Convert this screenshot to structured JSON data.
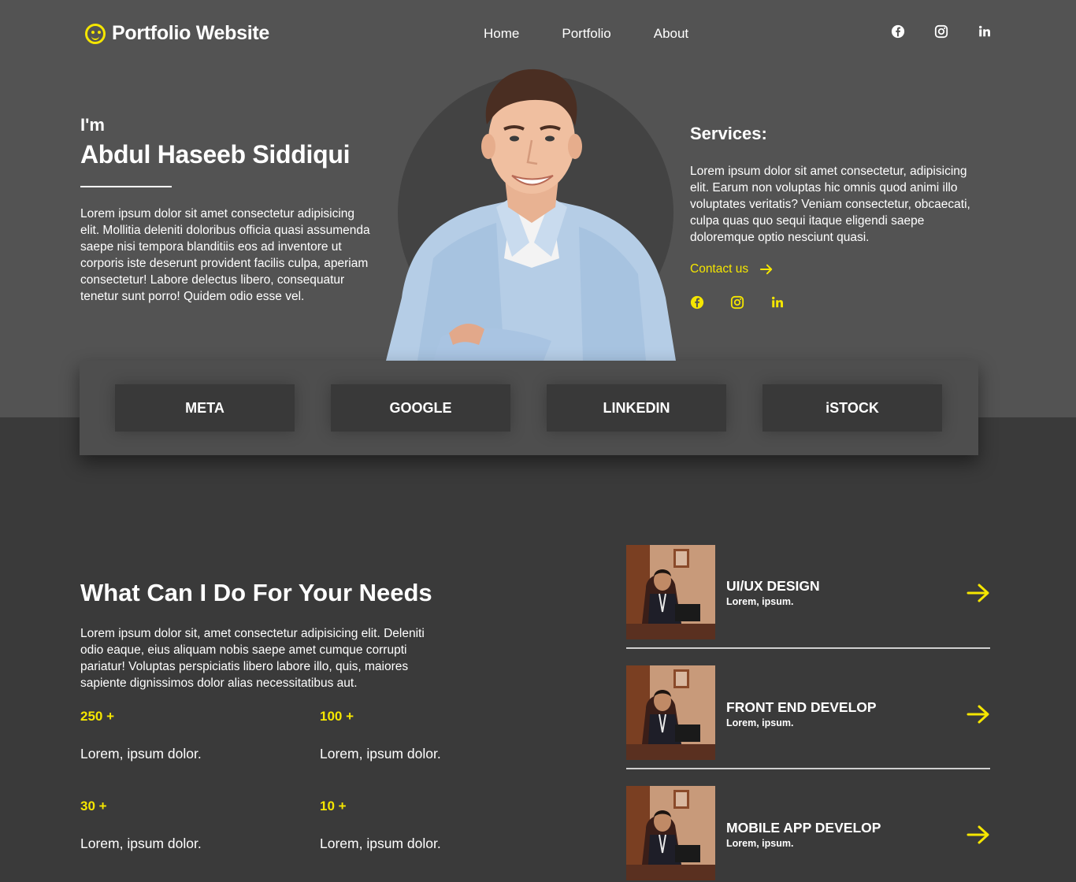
{
  "brand": {
    "logo_text": "Portfolio Website"
  },
  "nav": {
    "items": [
      "Home",
      "Portfolio",
      "About"
    ]
  },
  "hero": {
    "intro": "I'm",
    "name": "Abdul Haseeb Siddiqui",
    "bio": "Lorem ipsum dolor sit amet consectetur adipisicing elit. Mollitia deleniti doloribus officia quasi assumenda saepe nisi tempora blanditiis eos ad inventore ut corporis iste deserunt provident facilis culpa, aperiam consectetur! Labore delectus libero, consequatur tenetur sunt porro! Quidem odio esse vel."
  },
  "services": {
    "heading": "Services:",
    "text": "Lorem ipsum dolor sit amet consectetur, adipisicing elit. Earum non voluptas hic omnis quod animi illo voluptates veritatis? Veniam consectetur, obcaecati, culpa quas quo sequi itaque eligendi saepe doloremque optio nesciunt quasi.",
    "contact_label": "Contact us"
  },
  "brands": [
    "META",
    "GOOGLE",
    "LINKEDIN",
    "iSTOCK"
  ],
  "needs": {
    "heading": "What Can I Do For Your Needs",
    "text": "Lorem ipsum dolor sit, amet consectetur adipisicing elit. Deleniti odio eaque, eius aliquam nobis saepe amet cumque corrupti pariatur! Voluptas perspiciatis libero labore illo, quis, maiores sapiente dignissimos dolor alias necessitatibus aut.",
    "stats": [
      {
        "value": "250 +",
        "label": "Lorem, ipsum dolor."
      },
      {
        "value": "100 +",
        "label": "Lorem, ipsum dolor."
      },
      {
        "value": "30 +",
        "label": "Lorem, ipsum dolor."
      },
      {
        "value": "10 +",
        "label": "Lorem, ipsum dolor."
      }
    ]
  },
  "service_list": [
    {
      "title": "UI/UX DESIGN",
      "subtitle": "Lorem, ipsum."
    },
    {
      "title": "FRONT END DEVELOP",
      "subtitle": "Lorem, ipsum."
    },
    {
      "title": "MOBILE APP DEVELOP",
      "subtitle": "Lorem, ipsum."
    }
  ],
  "colors": {
    "accent": "#f5e600",
    "hero_bg": "#535353",
    "page_bg": "#3a3a3a"
  },
  "icons": [
    "smiley-icon",
    "facebook-icon",
    "instagram-icon",
    "linkedin-icon",
    "arrow-right-icon"
  ]
}
